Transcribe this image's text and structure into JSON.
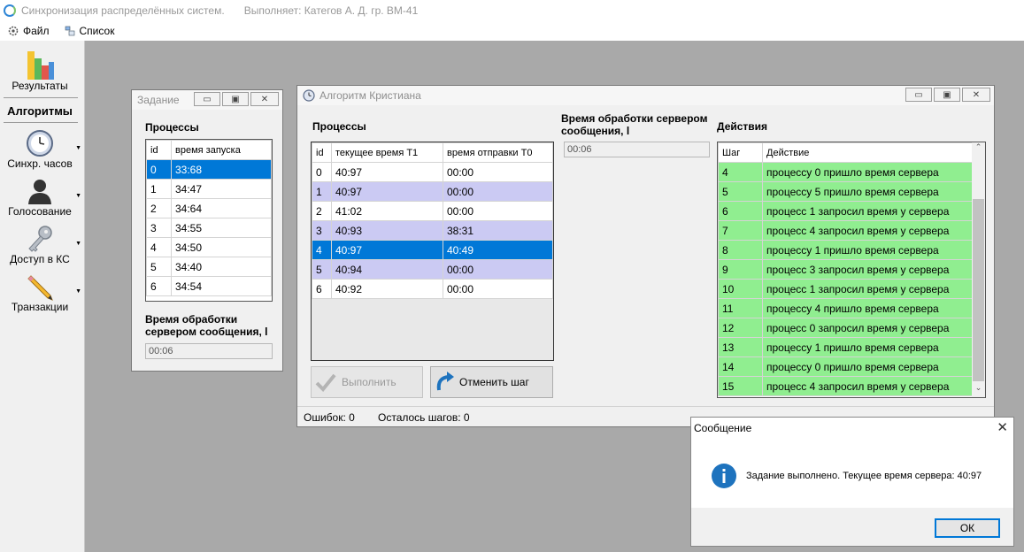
{
  "title_bar": {
    "app_title": "Синхронизация распределённых систем.",
    "performer": "Выполняет:  Категов А. Д.  гр. ВМ-41"
  },
  "menu": {
    "items": [
      {
        "label": "Файл",
        "icon": "gear-doc-icon"
      },
      {
        "label": "Список",
        "icon": "list-icon"
      }
    ]
  },
  "sidebar": {
    "results_label": "Результаты",
    "algorithms_title": "Алгоритмы",
    "items": [
      {
        "label": "Синхр. часов",
        "icon": "clock-icon"
      },
      {
        "label": "Голосование",
        "icon": "person-icon"
      },
      {
        "label": "Доступ в КС",
        "icon": "key-icon"
      },
      {
        "label": "Транзакции",
        "icon": "pencil-icon"
      }
    ]
  },
  "task_window": {
    "title": "Задание",
    "processes_title": "Процессы",
    "columns": [
      "id",
      "время запуска"
    ],
    "rows": [
      [
        "0",
        "33:68"
      ],
      [
        "1",
        "34:47"
      ],
      [
        "2",
        "34:64"
      ],
      [
        "3",
        "34:55"
      ],
      [
        "4",
        "34:50"
      ],
      [
        "5",
        "34:40"
      ],
      [
        "6",
        "34:54"
      ]
    ],
    "selected_row": 0,
    "server_time_label_line1": "Время обработки",
    "server_time_label_line2": "сервером сообщения, l",
    "server_time_value": "00:06"
  },
  "cristian_window": {
    "title": "Алгоритм Кристиана",
    "processes_title": "Процессы",
    "columns": [
      "id",
      "текущее время T1",
      "время отправки T0"
    ],
    "rows": [
      [
        "0",
        "40:97",
        "00:00"
      ],
      [
        "1",
        "40:97",
        "00:00"
      ],
      [
        "2",
        "41:02",
        "00:00"
      ],
      [
        "3",
        "40:93",
        "38:31"
      ],
      [
        "4",
        "40:97",
        "40:49"
      ],
      [
        "5",
        "40:94",
        "00:00"
      ],
      [
        "6",
        "40:92",
        "00:00"
      ]
    ],
    "server_time_label_line1": "Время обработки сервером",
    "server_time_label_line2": "сообщения, l",
    "server_time_value": "00:06",
    "actions_title": "Действия",
    "actions_columns": [
      "Шаг",
      "Действие"
    ],
    "actions": [
      [
        "4",
        "процессу 0 пришло время сервера"
      ],
      [
        "5",
        "процессу 5 пришло время сервера"
      ],
      [
        "6",
        "процесс 1 запросил время у сервера"
      ],
      [
        "7",
        "процесс 4 запросил время у сервера"
      ],
      [
        "8",
        "процессу 1 пришло время сервера"
      ],
      [
        "9",
        "процесс 3 запросил время у сервера"
      ],
      [
        "10",
        "процесс 1 запросил время у сервера"
      ],
      [
        "11",
        "процессу 4 пришло время сервера"
      ],
      [
        "12",
        "процесс 0 запросил время у сервера"
      ],
      [
        "13",
        "процессу 1 пришло время сервера"
      ],
      [
        "14",
        "процессу 0 пришло время сервера"
      ],
      [
        "15",
        "процесс 4 запросил время у сервера"
      ]
    ],
    "execute_label": "Выполнить",
    "undo_label": "Отменить шаг",
    "errors_label": "Ошибок: 0",
    "steps_left_label": "Осталось шагов: 0"
  },
  "message_box": {
    "title": "Сообщение",
    "text": "Задание выполнено. Текущее время сервера: 40:97",
    "ok_label": "ОК"
  },
  "colors": {
    "selection": "#0078d7",
    "alt_row": "#cbcaf3",
    "action_row": "#90ee90",
    "mdi_background": "#a9a9a9"
  }
}
